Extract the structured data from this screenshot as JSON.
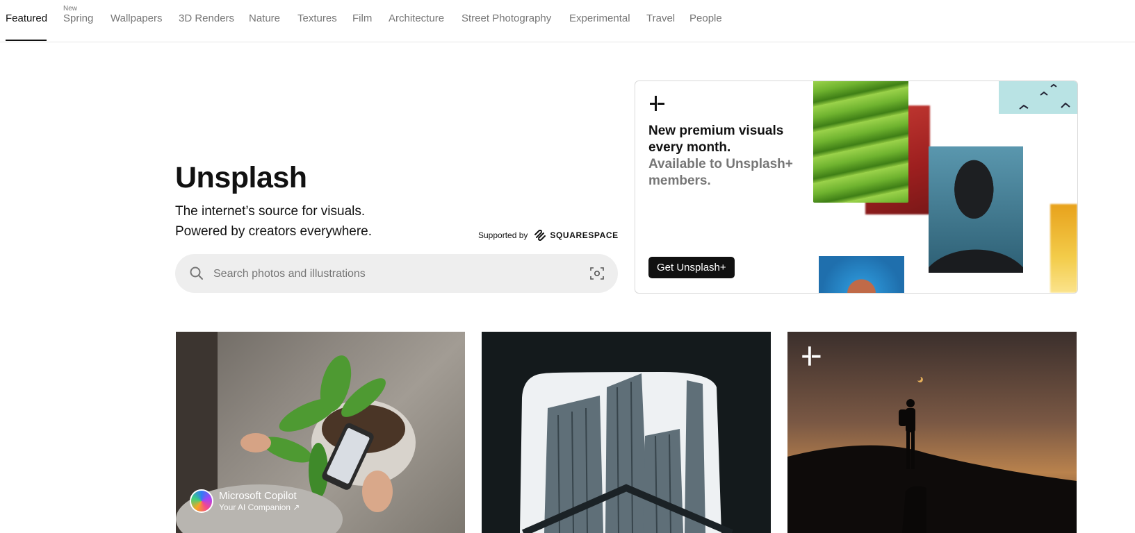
{
  "nav": {
    "items": [
      {
        "label": "Featured"
      },
      {
        "label": "Spring",
        "badge": "New"
      },
      {
        "label": "Wallpapers"
      },
      {
        "label": "3D Renders"
      },
      {
        "label": "Nature"
      },
      {
        "label": "Textures"
      },
      {
        "label": "Film"
      },
      {
        "label": "Architecture"
      },
      {
        "label": "Street Photography"
      },
      {
        "label": "Experimental"
      },
      {
        "label": "Travel"
      },
      {
        "label": "People"
      }
    ],
    "active": "Featured"
  },
  "hero": {
    "title": "Unsplash",
    "line1": "The internet’s source for visuals.",
    "line2": "Powered by creators everywhere.",
    "supported_label": "Supported by",
    "sponsor": "SQUARESPACE"
  },
  "search": {
    "placeholder": "Search photos and illustrations",
    "value": ""
  },
  "promo": {
    "headline": "New premium visuals every month.",
    "subline": "Available to Unsplash+ members.",
    "button_label": "Get Unsplash+"
  },
  "photos": [
    {
      "subject": "plant-and-phone",
      "sponsor_name": "Microsoft Copilot",
      "sponsor_tagline": "Your AI Companion ↗"
    },
    {
      "subject": "skyscrapers-through-window"
    },
    {
      "subject": "hiker-silhouette-at-dusk",
      "badge": "unsplash-plus-icon"
    }
  ],
  "icons": {
    "search": "search-icon",
    "visual_search": "visual-search-icon",
    "unsplash_plus": "unsplash-plus-icon"
  },
  "colors": {
    "text": "#111111",
    "muted": "#767676",
    "search_bg": "#eeeeee",
    "button_bg": "#111111"
  }
}
